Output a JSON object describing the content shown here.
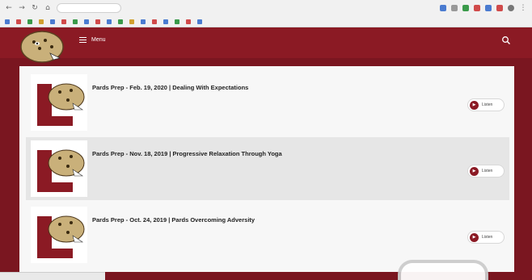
{
  "browser": {
    "url": "",
    "bookmarks": [
      {
        "label": "",
        "color": "#4a7bd0"
      },
      {
        "label": "",
        "color": "#d04a4a"
      },
      {
        "label": "",
        "color": "#3a9a4a"
      },
      {
        "label": "",
        "color": "#d0a030"
      },
      {
        "label": "",
        "color": "#4a7bd0"
      },
      {
        "label": "",
        "color": "#d04a4a"
      },
      {
        "label": "",
        "color": "#3a9a4a"
      },
      {
        "label": "",
        "color": "#4a7bd0"
      },
      {
        "label": "",
        "color": "#d04a4a"
      },
      {
        "label": "",
        "color": "#4a7bd0"
      },
      {
        "label": "",
        "color": "#3a9a4a"
      },
      {
        "label": "",
        "color": "#d0a030"
      },
      {
        "label": "",
        "color": "#4a7bd0"
      },
      {
        "label": "",
        "color": "#d04a4a"
      },
      {
        "label": "",
        "color": "#4a7bd0"
      },
      {
        "label": "",
        "color": "#3a9a4a"
      },
      {
        "label": "",
        "color": "#d04a4a"
      },
      {
        "label": "",
        "color": "#4a7bd0"
      }
    ]
  },
  "site": {
    "menu_label": "Menu",
    "brand_color": "#8b1a24",
    "search_icon": "search-icon",
    "logo": "leopard-logo"
  },
  "episodes": [
    {
      "date": "",
      "title": "Pards Prep - Feb. 19, 2020 | Dealing With Expectations",
      "description": "",
      "listen_label": "Listen"
    },
    {
      "date": "",
      "title": "Pards Prep - Nov. 18, 2019 | Progressive Relaxation Through Yoga",
      "description": "",
      "listen_label": "Listen"
    },
    {
      "date": "",
      "title": "Pards Prep - Oct. 24, 2019 | Pards Overcoming Adversity",
      "description": "",
      "listen_label": "Listen"
    }
  ],
  "statusbar": {
    "text": ""
  }
}
